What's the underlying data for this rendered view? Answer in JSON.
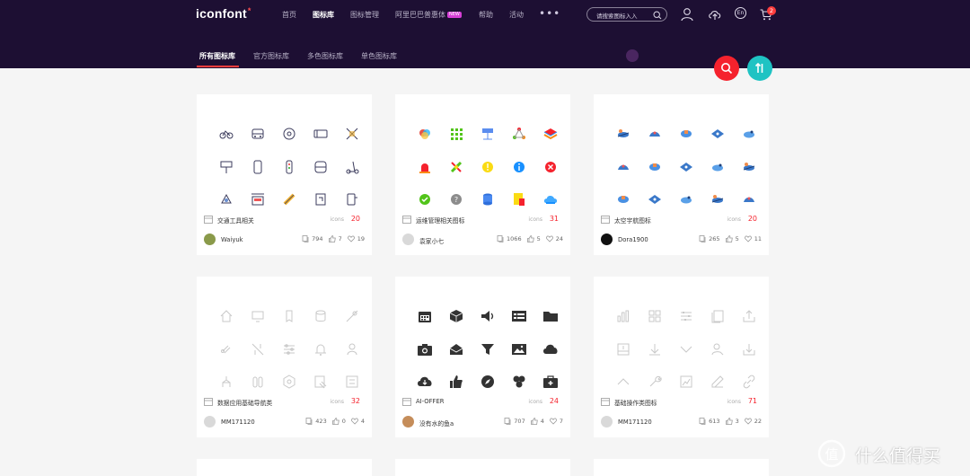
{
  "header": {
    "logo": "iconfont",
    "logo_mark": "*",
    "nav": [
      {
        "label": "首页",
        "active": false
      },
      {
        "label": "图标库",
        "active": true
      },
      {
        "label": "图标管理",
        "active": false
      },
      {
        "label": "阿里巴巴普惠体",
        "active": false,
        "badge": "NEW"
      },
      {
        "label": "帮助",
        "active": false
      },
      {
        "label": "活动",
        "active": false
      }
    ],
    "more": "•••",
    "search_placeholder": "请搜索图标入入",
    "lang": "En",
    "cart_count": "2"
  },
  "subnav": [
    {
      "label": "所有图标库",
      "active": true
    },
    {
      "label": "官方图标库",
      "active": false
    },
    {
      "label": "多色图标库",
      "active": false
    },
    {
      "label": "单色图标库",
      "active": false
    }
  ],
  "cards": [
    {
      "title": "交通工具相关",
      "icons_label": "icons",
      "count": "20",
      "author": "Waiyuk",
      "views": "794",
      "likes": "7",
      "favs": "19",
      "style": "transport",
      "avatar_color": "#8a9a4a"
    },
    {
      "title": "运维管理相关图标",
      "icons_label": "icons",
      "count": "31",
      "author": "袁家小七",
      "views": "1066",
      "likes": "5",
      "favs": "24",
      "style": "ops",
      "avatar_color": "#d9d9d9"
    },
    {
      "title": "太空宇航图标",
      "icons_label": "icons",
      "count": "20",
      "author": "Dora1900",
      "views": "265",
      "likes": "5",
      "favs": "11",
      "style": "space",
      "avatar_color": "#111"
    },
    {
      "title": "数据应用基础导航类",
      "icons_label": "icons",
      "count": "32",
      "author": "MM171120",
      "views": "423",
      "likes": "0",
      "favs": "4",
      "style": "data",
      "avatar_color": "#d9d9d9"
    },
    {
      "title": "AI-OFFER",
      "icons_label": "icons",
      "count": "24",
      "author": "没有水的鱼a",
      "views": "707",
      "likes": "4",
      "favs": "7",
      "style": "ai",
      "avatar_color": "#c58d5a"
    },
    {
      "title": "基础操作类图标",
      "icons_label": "icons",
      "count": "71",
      "author": "MM171120",
      "views": "613",
      "likes": "3",
      "favs": "22",
      "style": "basic",
      "avatar_color": "#d9d9d9"
    }
  ],
  "watermark": "什么值得买",
  "colors": {
    "header_bg": "#1d0f33",
    "accent_red": "#f5222d",
    "accent_teal": "#1fc3c3"
  }
}
